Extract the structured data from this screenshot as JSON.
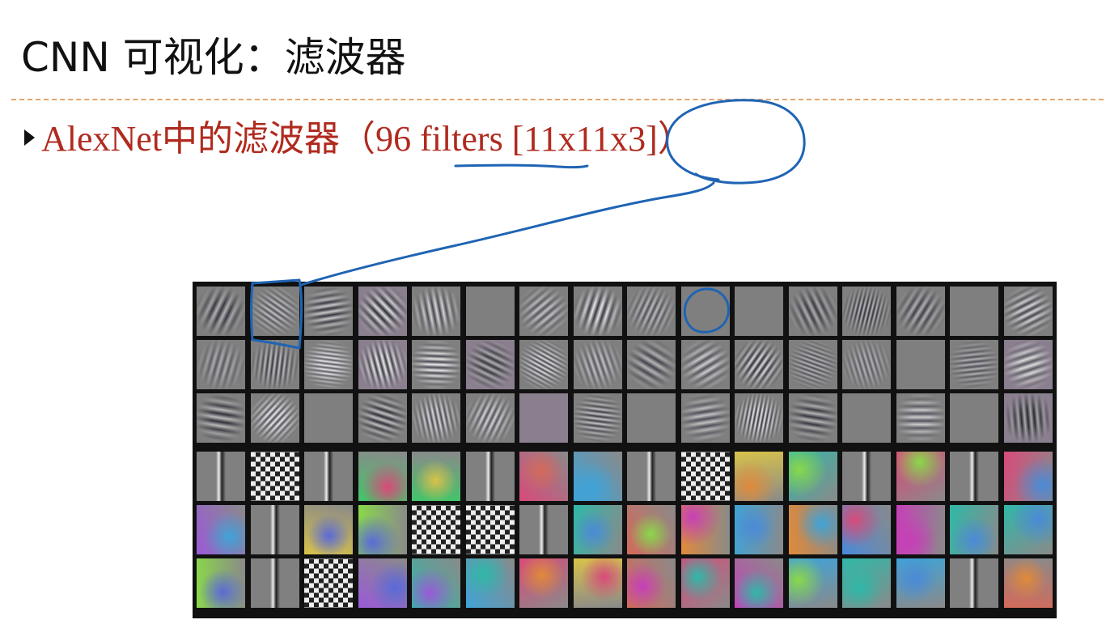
{
  "slide": {
    "title": "CNN 可视化：滤波器",
    "bullet": {
      "prefix": "AlexNet中的滤波器（",
      "count_phrase": "96 filters",
      "bracket_open": " [",
      "dims": "11x11x3",
      "suffix": "]）"
    }
  },
  "figure": {
    "rows": 6,
    "cols": 16,
    "groups": [
      {
        "kind": "grayscale-oriented",
        "rows": 3
      },
      {
        "kind": "color-blob",
        "rows": 3
      }
    ]
  },
  "annotation": {
    "ink_color": "#1f64b4"
  }
}
